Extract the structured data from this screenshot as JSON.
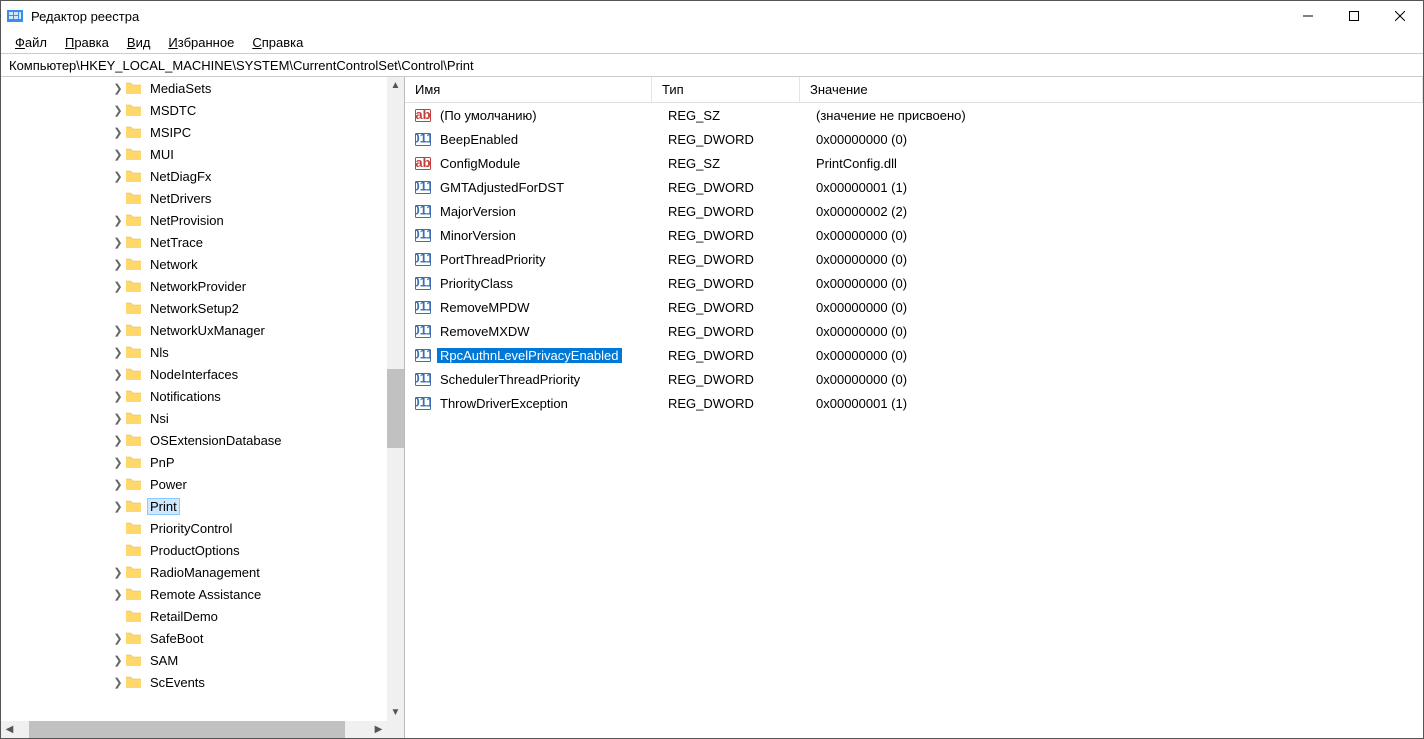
{
  "window": {
    "title": "Редактор реестра"
  },
  "menu": {
    "file": "Файл",
    "edit": "Правка",
    "view": "Вид",
    "favorites": "Избранное",
    "help": "Справка",
    "file_u": "Ф",
    "edit_u": "П",
    "view_u": "В",
    "fav_u": "И",
    "help_u": "С"
  },
  "address": "Компьютер\\HKEY_LOCAL_MACHINE\\SYSTEM\\CurrentControlSet\\Control\\Print",
  "tree": [
    {
      "indent": 110,
      "exp": true,
      "label": "MediaSets"
    },
    {
      "indent": 110,
      "exp": true,
      "label": "MSDTC"
    },
    {
      "indent": 110,
      "exp": true,
      "label": "MSIPC"
    },
    {
      "indent": 110,
      "exp": true,
      "label": "MUI"
    },
    {
      "indent": 110,
      "exp": true,
      "label": "NetDiagFx"
    },
    {
      "indent": 110,
      "exp": false,
      "label": "NetDrivers"
    },
    {
      "indent": 110,
      "exp": true,
      "label": "NetProvision"
    },
    {
      "indent": 110,
      "exp": true,
      "label": "NetTrace"
    },
    {
      "indent": 110,
      "exp": true,
      "label": "Network"
    },
    {
      "indent": 110,
      "exp": true,
      "label": "NetworkProvider"
    },
    {
      "indent": 110,
      "exp": false,
      "label": "NetworkSetup2"
    },
    {
      "indent": 110,
      "exp": true,
      "label": "NetworkUxManager"
    },
    {
      "indent": 110,
      "exp": true,
      "label": "Nls"
    },
    {
      "indent": 110,
      "exp": true,
      "label": "NodeInterfaces"
    },
    {
      "indent": 110,
      "exp": true,
      "label": "Notifications"
    },
    {
      "indent": 110,
      "exp": true,
      "label": "Nsi"
    },
    {
      "indent": 110,
      "exp": true,
      "label": "OSExtensionDatabase"
    },
    {
      "indent": 110,
      "exp": true,
      "label": "PnP"
    },
    {
      "indent": 110,
      "exp": true,
      "label": "Power"
    },
    {
      "indent": 110,
      "exp": true,
      "label": "Print",
      "selected": true
    },
    {
      "indent": 110,
      "exp": false,
      "label": "PriorityControl"
    },
    {
      "indent": 110,
      "exp": false,
      "label": "ProductOptions"
    },
    {
      "indent": 110,
      "exp": true,
      "label": "RadioManagement"
    },
    {
      "indent": 110,
      "exp": true,
      "label": "Remote Assistance"
    },
    {
      "indent": 110,
      "exp": false,
      "label": "RetailDemo"
    },
    {
      "indent": 110,
      "exp": true,
      "label": "SafeBoot"
    },
    {
      "indent": 110,
      "exp": true,
      "label": "SAM"
    },
    {
      "indent": 110,
      "exp": true,
      "label": "ScEvents"
    }
  ],
  "columns": {
    "name": "Имя",
    "type": "Тип",
    "value": "Значение"
  },
  "values": [
    {
      "icon": "sz",
      "name": "(По умолчанию)",
      "type": "REG_SZ",
      "value": "(значение не присвоено)"
    },
    {
      "icon": "dw",
      "name": "BeepEnabled",
      "type": "REG_DWORD",
      "value": "0x00000000 (0)"
    },
    {
      "icon": "sz",
      "name": "ConfigModule",
      "type": "REG_SZ",
      "value": "PrintConfig.dll"
    },
    {
      "icon": "dw",
      "name": "GMTAdjustedForDST",
      "type": "REG_DWORD",
      "value": "0x00000001 (1)"
    },
    {
      "icon": "dw",
      "name": "MajorVersion",
      "type": "REG_DWORD",
      "value": "0x00000002 (2)"
    },
    {
      "icon": "dw",
      "name": "MinorVersion",
      "type": "REG_DWORD",
      "value": "0x00000000 (0)"
    },
    {
      "icon": "dw",
      "name": "PortThreadPriority",
      "type": "REG_DWORD",
      "value": "0x00000000 (0)"
    },
    {
      "icon": "dw",
      "name": "PriorityClass",
      "type": "REG_DWORD",
      "value": "0x00000000 (0)"
    },
    {
      "icon": "dw",
      "name": "RemoveMPDW",
      "type": "REG_DWORD",
      "value": "0x00000000 (0)"
    },
    {
      "icon": "dw",
      "name": "RemoveMXDW",
      "type": "REG_DWORD",
      "value": "0x00000000 (0)"
    },
    {
      "icon": "dw",
      "name": "RpcAuthnLevelPrivacyEnabled",
      "type": "REG_DWORD",
      "value": "0x00000000 (0)",
      "selected": true
    },
    {
      "icon": "dw",
      "name": "SchedulerThreadPriority",
      "type": "REG_DWORD",
      "value": "0x00000000 (0)"
    },
    {
      "icon": "dw",
      "name": "ThrowDriverException",
      "type": "REG_DWORD",
      "value": "0x00000001 (1)"
    }
  ]
}
